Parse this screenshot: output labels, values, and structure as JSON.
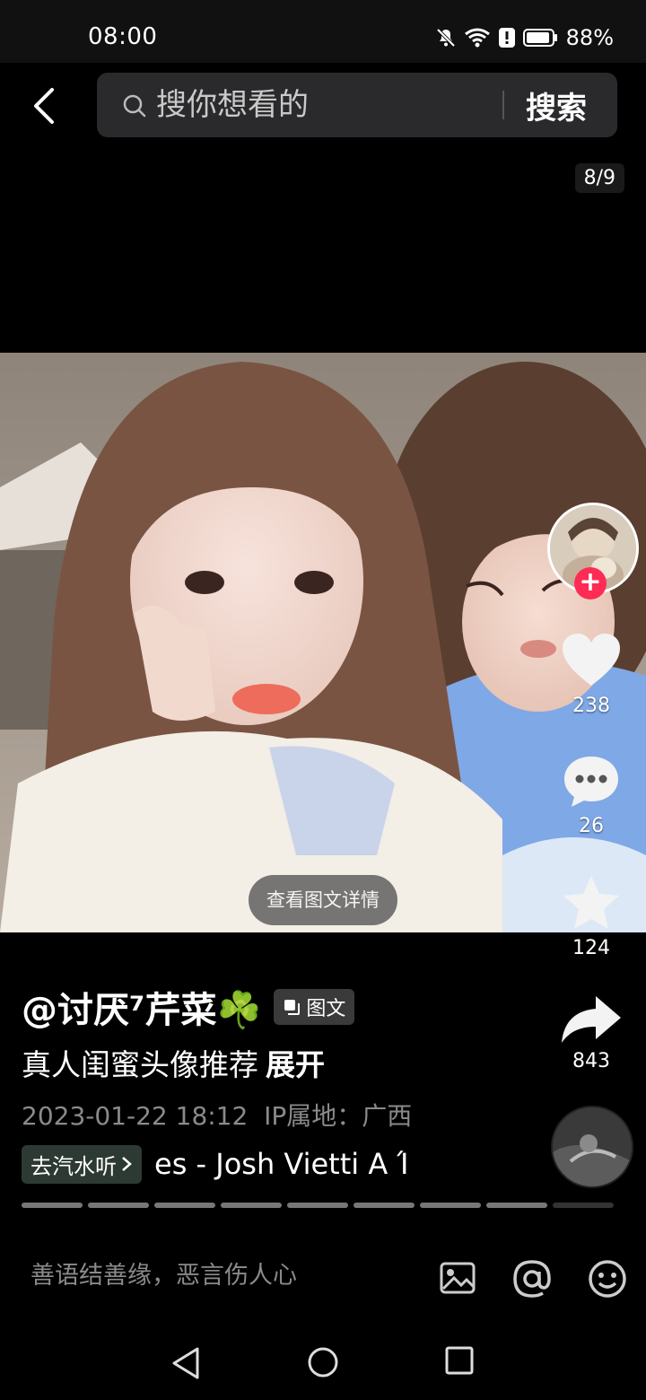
{
  "status_bar": {
    "time": "08:00",
    "battery": "88%"
  },
  "search": {
    "placeholder": "搜你想看的",
    "button_label": "搜索"
  },
  "page_counter": "8/9",
  "post": {
    "view_detail_label": "查看图文详情",
    "username": "@讨厌⁷芹菜☘️",
    "type_badge": "图文",
    "description": "真人闺蜜头像推荐",
    "expand_label": "展开",
    "timestamp": "2023-01-22 18:12",
    "ip_location": "IP属地：广西",
    "music_chip_label": "去汽水听",
    "music_title": "es - Josh Vietti    A Ί"
  },
  "actions": {
    "likes": "238",
    "comments": "26",
    "favorites": "124",
    "shares": "843"
  },
  "progress": {
    "total_segments": 9,
    "current_segment": 8
  },
  "comment_bar": {
    "placeholder": "善语结善缘，恶言伤人心"
  },
  "colors": {
    "accent_red": "#fe2c55",
    "background": "#000000"
  },
  "icons": [
    "back-arrow-icon",
    "search-icon",
    "mute-icon",
    "wifi-icon",
    "alert-icon",
    "battery-icon",
    "heart-icon",
    "comment-icon",
    "star-icon",
    "share-icon",
    "image-icon",
    "at-icon",
    "emoji-icon",
    "nav-back-icon",
    "nav-home-icon",
    "nav-recents-icon"
  ]
}
